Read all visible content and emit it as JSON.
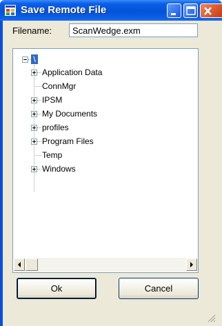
{
  "window": {
    "title": "Save Remote File",
    "icon": "window-app-icon",
    "controls": [
      "minimize-icon",
      "maximize-icon",
      "close-icon"
    ]
  },
  "form": {
    "filename_label": "Filename:",
    "filename_value": "ScanWedge.exm"
  },
  "tree": {
    "root": "\\",
    "items": [
      {
        "label": "Application Data",
        "expandable": true
      },
      {
        "label": "ConnMgr",
        "expandable": false
      },
      {
        "label": "IPSM",
        "expandable": true
      },
      {
        "label": "My Documents",
        "expandable": true
      },
      {
        "label": "profiles",
        "expandable": true
      },
      {
        "label": "Program Files",
        "expandable": true
      },
      {
        "label": "Temp",
        "expandable": false
      },
      {
        "label": "Windows",
        "expandable": true
      }
    ]
  },
  "buttons": {
    "ok": "Ok",
    "cancel": "Cancel"
  },
  "colors": {
    "titlebar": "#0453d8",
    "dialog_bg": "#ece9d8",
    "selection": "#316ac5"
  }
}
